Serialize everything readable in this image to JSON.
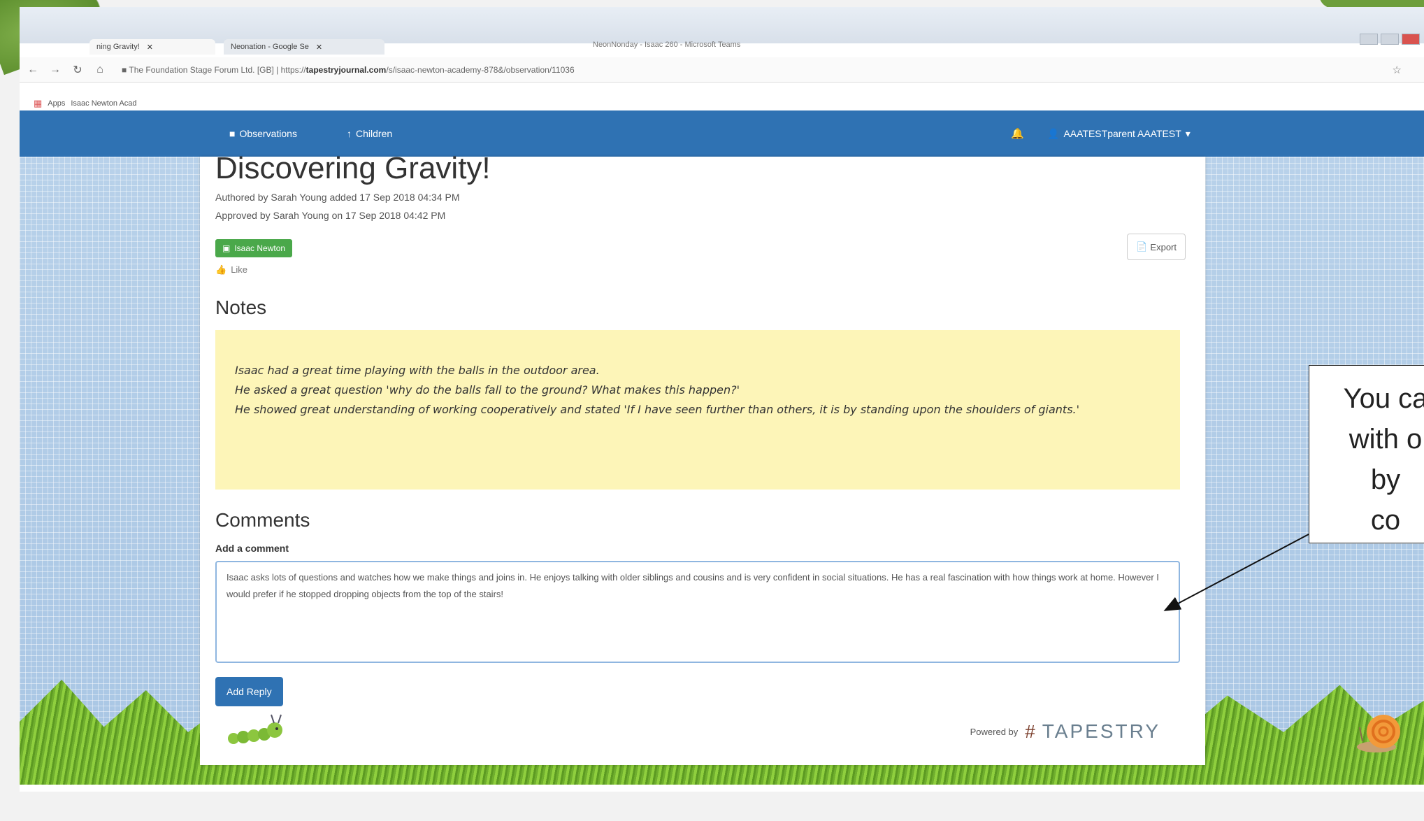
{
  "browser": {
    "tabs": [
      {
        "label": "ning Gravity!"
      },
      {
        "label": "Neonation - Google Se"
      }
    ],
    "window_title": "NeonNonday - Isaac 260 - Microsoft Teams",
    "url_site": "The Foundation Stage Forum Ltd. [GB]",
    "url_prefix": "https://",
    "url_domain": "tapestryjournal.com",
    "url_path": "/s/isaac-newton-academy-878&/observation/11036",
    "bookmarks": [
      {
        "label": "Apps"
      },
      {
        "label": "Isaac Newton Acad"
      }
    ]
  },
  "navbar": {
    "observations": "Observations",
    "children": "Children",
    "user": "AAATESTparent AAATEST"
  },
  "observation": {
    "title": "Discovering Gravity!",
    "authored": "Authored by Sarah Young added 17 Sep 2018 04:34 PM",
    "approved": "Approved by Sarah Young on 17 Sep 2018 04:42 PM",
    "child_tag": "Isaac Newton",
    "like": "Like",
    "export": "Export"
  },
  "notes": {
    "heading": "Notes",
    "lines": [
      "Isaac had a great time playing with the balls in the outdoor area.",
      "He asked a great question 'why do the balls fall to the ground? What makes this happen?'",
      "He showed great understanding of working cooperatively and stated 'If I have seen further than others, it is by standing upon the shoulders of giants.'"
    ]
  },
  "comments": {
    "heading": "Comments",
    "add_label": "Add a comment",
    "text": "Isaac asks lots of questions and watches how we make things and joins in. He enjoys talking with older siblings and cousins and is very confident in social situations. He has a real fascination with how things work at home. However I would prefer if he stopped dropping objects from the top of the stairs!",
    "reply_button": "Add Reply"
  },
  "footer": {
    "powered_by": "Powered by",
    "brand": "TAPESTRY"
  },
  "callout": {
    "lines": [
      "You ca",
      "with o",
      "by",
      "co"
    ]
  },
  "colors": {
    "navbar": "#2f72b3",
    "notes_bg": "#fdf5b8",
    "child_tag": "#4aa84a"
  }
}
